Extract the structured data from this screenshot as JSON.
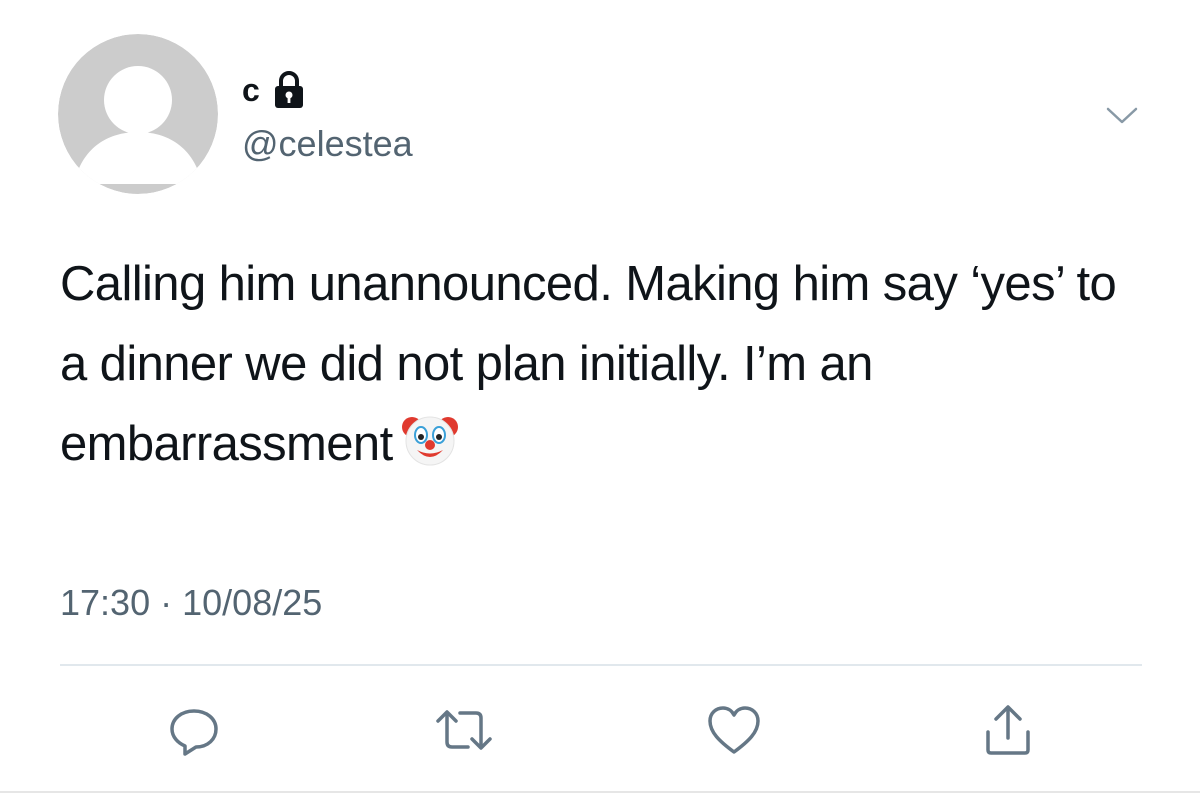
{
  "author": {
    "display_name": "c",
    "handle": "@celestea",
    "avatar_icon": "default-avatar-icon",
    "protected_icon": "lock-icon"
  },
  "tweet": {
    "text": "Calling him unannounced. Making him say ‘yes’ to a dinner we did not plan initially. I’m an embarrassment",
    "emoji_icon": "clown-face-emoji",
    "time": "17:30",
    "separator": "·",
    "date": "10/08/25"
  },
  "actions": [
    {
      "name": "reply",
      "icon": "reply-icon"
    },
    {
      "name": "retweet",
      "icon": "retweet-icon"
    },
    {
      "name": "like",
      "icon": "heart-icon"
    },
    {
      "name": "share",
      "icon": "share-icon"
    }
  ],
  "colors": {
    "text_primary": "#0f1419",
    "text_secondary": "#536471",
    "icon_gray": "#657786",
    "divider": "#e1e8ed",
    "avatar_bg": "#cccccc"
  }
}
